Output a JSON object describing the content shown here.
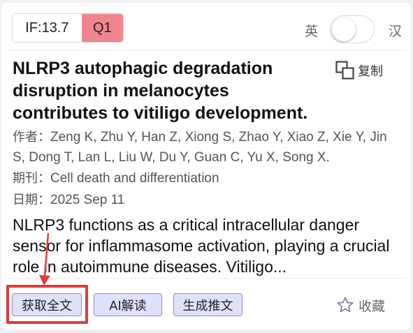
{
  "badges": {
    "impact_factor": "IF:13.7",
    "quartile": "Q1",
    "quartile_color": "#f08590"
  },
  "language_toggle": {
    "left_label": "英",
    "right_label": "汉",
    "state": "off"
  },
  "article": {
    "title": "NLRP3 autophagic degradation disruption in melanocytes contributes to vitiligo development.",
    "copy_label": "复制",
    "authors_label": "作者：",
    "authors": "Zeng K, Zhu Y, Han Z, Xiong S, Zhao Y, Xiao Z, Xie Y, Jin S, Dong T, Lan L, Liu W, Du Y, Guan C, Yu X, Song X.",
    "journal_label": "期刊：",
    "journal": "Cell death and differentiation",
    "date_label": "日期：",
    "date": "2025 Sep 11",
    "abstract": "NLRP3 functions as a critical intracellular danger sensor for inflammasome activation, playing a crucial role in autoimmune diseases. Vitiligo..."
  },
  "actions": {
    "get_full_text": "获取全文",
    "ai_interpret": "AI解读",
    "generate_post": "生成推文",
    "favorite": "收藏"
  },
  "colors": {
    "button_bg": "#dee2fb",
    "button_border": "#8892b8",
    "annotation_red": "#e33a3a"
  }
}
